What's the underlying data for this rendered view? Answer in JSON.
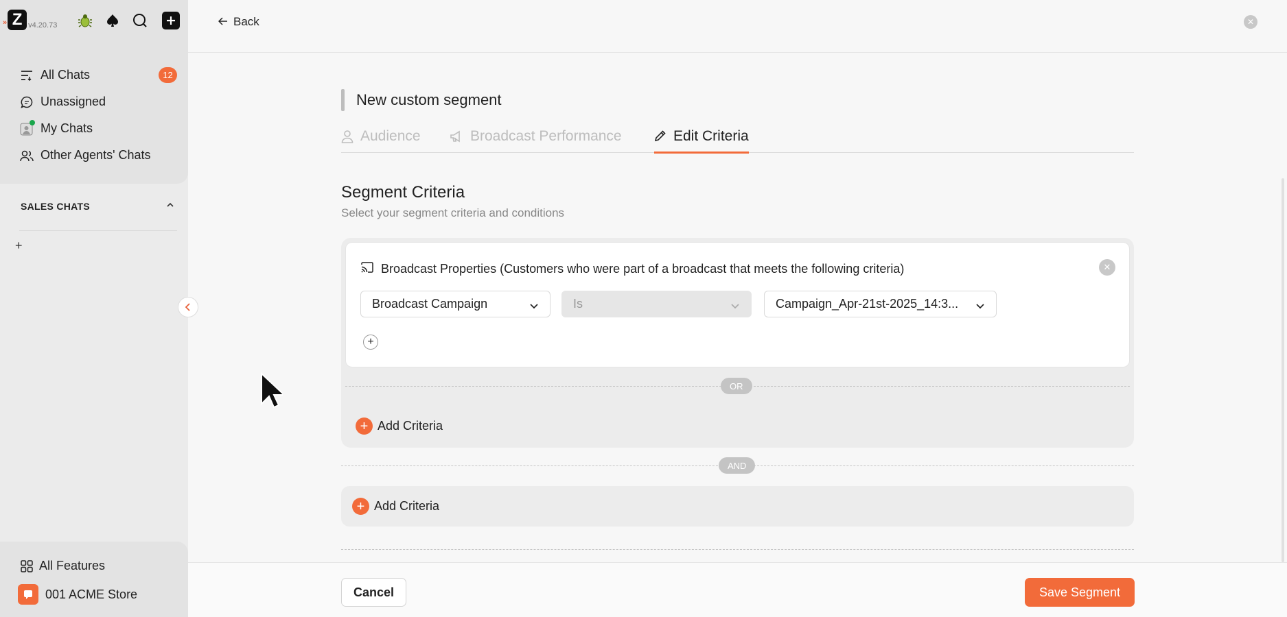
{
  "app": {
    "version": "v4.20.73"
  },
  "sidebar": {
    "items": [
      {
        "label": "All Chats",
        "badge": "12"
      },
      {
        "label": "Unassigned"
      },
      {
        "label": "My Chats"
      },
      {
        "label": "Other Agents' Chats"
      }
    ],
    "section_title": "SALES CHATS",
    "bottom": {
      "all_features": "All Features",
      "store_name": "001 ACME Store"
    }
  },
  "header": {
    "back_label": "Back"
  },
  "page": {
    "title": "New custom segment",
    "tabs": [
      {
        "label": "Audience",
        "active": false
      },
      {
        "label": "Broadcast Performance",
        "active": false
      },
      {
        "label": "Edit Criteria",
        "active": true
      }
    ],
    "section_title": "Segment Criteria",
    "section_subtitle": "Select your segment criteria and conditions",
    "criteria_card": {
      "heading": "Broadcast Properties (Customers who were part of a broadcast that meets the following criteria)",
      "field": "Broadcast Campaign",
      "operator": "Is",
      "value": "Campaign_Apr-21st-2025_14:3..."
    },
    "or_label": "OR",
    "and_label": "AND",
    "add_criteria_label": "Add Criteria"
  },
  "footer": {
    "cancel_label": "Cancel",
    "save_label": "Save Segment"
  },
  "colors": {
    "accent": "#f26b3a",
    "muted": "#bdbdbd"
  }
}
